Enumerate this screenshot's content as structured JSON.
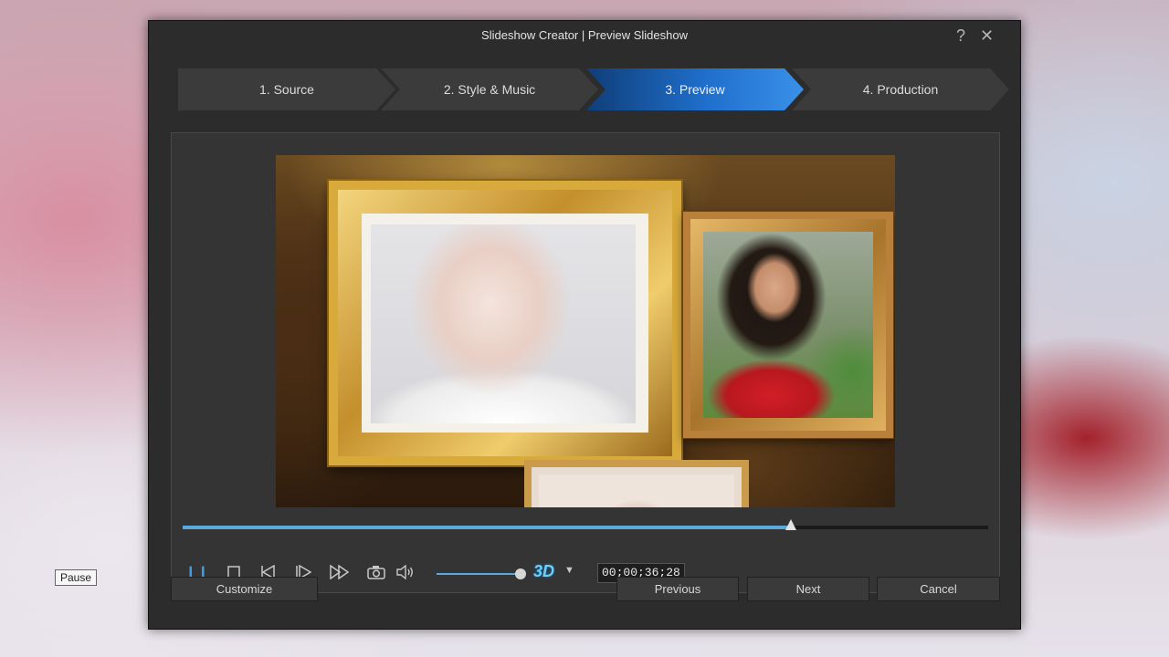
{
  "window": {
    "title": "Slideshow Creator | Preview Slideshow",
    "help_icon": "?",
    "close_icon": "✕"
  },
  "steps": [
    {
      "label": "1. Source",
      "active": false
    },
    {
      "label": "2. Style & Music",
      "active": false
    },
    {
      "label": "3. Preview",
      "active": true
    },
    {
      "label": "4. Production",
      "active": false
    }
  ],
  "player": {
    "progress_fraction": 0.755,
    "volume_fraction": 0.96,
    "timecode": "00;00;36;28",
    "three_d_label": "3D",
    "icons": [
      "pause-icon",
      "stop-icon",
      "previous-frame-icon",
      "next-frame-icon",
      "fast-forward-icon",
      "snapshot-icon",
      "volume-icon",
      "dropdown-icon"
    ],
    "accent_color": "#5aa8dc"
  },
  "tooltip": "Pause",
  "buttons": {
    "customize": "Customize",
    "previous": "Previous",
    "next": "Next",
    "cancel": "Cancel"
  }
}
